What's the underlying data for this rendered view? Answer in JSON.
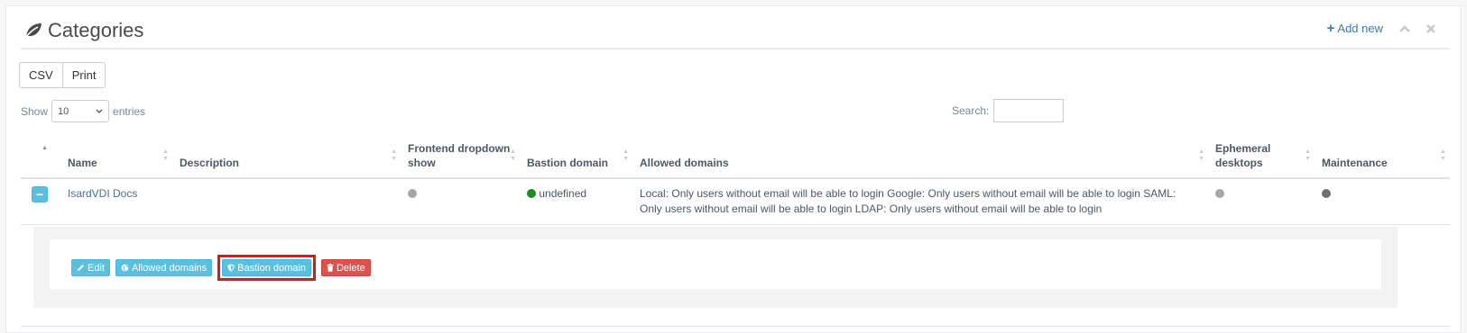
{
  "header": {
    "title": "Categories",
    "add_new_label": "Add new",
    "accent_color": "#337ab7"
  },
  "toolbar": {
    "csv_label": "CSV",
    "print_label": "Print"
  },
  "length_menu": {
    "show_label": "Show",
    "entries_label": "entries",
    "selected": "10"
  },
  "search": {
    "label": "Search:",
    "value": ""
  },
  "table": {
    "columns": [
      {
        "label": ""
      },
      {
        "label": "Name"
      },
      {
        "label": "Description"
      },
      {
        "label": "Frontend dropdown show"
      },
      {
        "label": "Bastion domain"
      },
      {
        "label": "Allowed domains"
      },
      {
        "label": "Ephemeral desktops"
      },
      {
        "label": "Maintenance"
      }
    ],
    "rows": [
      {
        "control": "−",
        "name": "IsardVDI Docs",
        "description": "",
        "frontend_status": "grey",
        "bastion_status": "green",
        "bastion_domain": "undefined",
        "allowed_domains": "Local: Only users without email will be able to login Google: Only users without email will be able to login SAML: Only users without email will be able to login LDAP: Only users without email will be able to login",
        "ephemeral_status": "grey",
        "maintenance_status": "dark"
      }
    ]
  },
  "row_actions": {
    "edit_label": "Edit",
    "allowed_domains_label": "Allowed domains",
    "bastion_domain_label": "Bastion domain",
    "delete_label": "Delete"
  }
}
